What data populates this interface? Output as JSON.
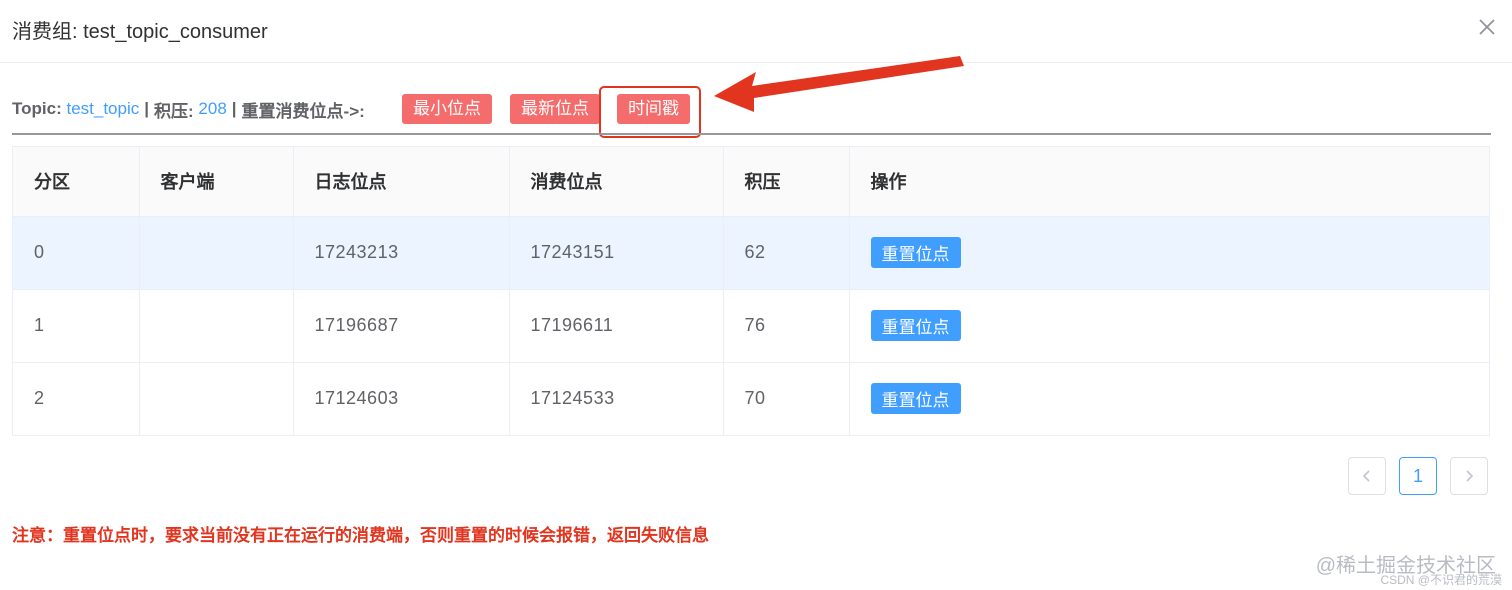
{
  "dialog": {
    "title": "消费组: test_topic_consumer"
  },
  "topic_line": {
    "topic_label": "Topic:",
    "topic_value": "test_topic",
    "sep1": "|",
    "backlog_label": "积压:",
    "backlog_value": "208",
    "sep2": "|",
    "reset_label": "重置消费位点->:"
  },
  "reset_buttons": {
    "min": "最小位点",
    "latest": "最新位点",
    "timestamp": "时间戳"
  },
  "table": {
    "headers": [
      "分区",
      "客户端",
      "日志位点",
      "消费位点",
      "积压",
      "操作"
    ],
    "rows": [
      {
        "partition": "0",
        "client": "",
        "log_offset": "17243213",
        "consume_offset": "17243151",
        "backlog": "62",
        "action": "重置位点"
      },
      {
        "partition": "1",
        "client": "",
        "log_offset": "17196687",
        "consume_offset": "17196611",
        "backlog": "76",
        "action": "重置位点"
      },
      {
        "partition": "2",
        "client": "",
        "log_offset": "17124603",
        "consume_offset": "17124533",
        "backlog": "70",
        "action": "重置位点"
      }
    ]
  },
  "pagination": {
    "prev": "<",
    "current": "1",
    "next": ">"
  },
  "notice": "注意：重置位点时，要求当前没有正在运行的消费端，否则重置的时候会报错，返回失败信息",
  "watermark": {
    "line1": "@稀土掘金技术社区",
    "line2": "CSDN @不识君的荒漠"
  },
  "colors": {
    "accent_blue": "#409eff",
    "danger_red": "#f56c6c",
    "annotation_red": "#e2351f"
  },
  "icons": {
    "close": "close-icon",
    "arrow": "annotation-arrow-icon"
  }
}
